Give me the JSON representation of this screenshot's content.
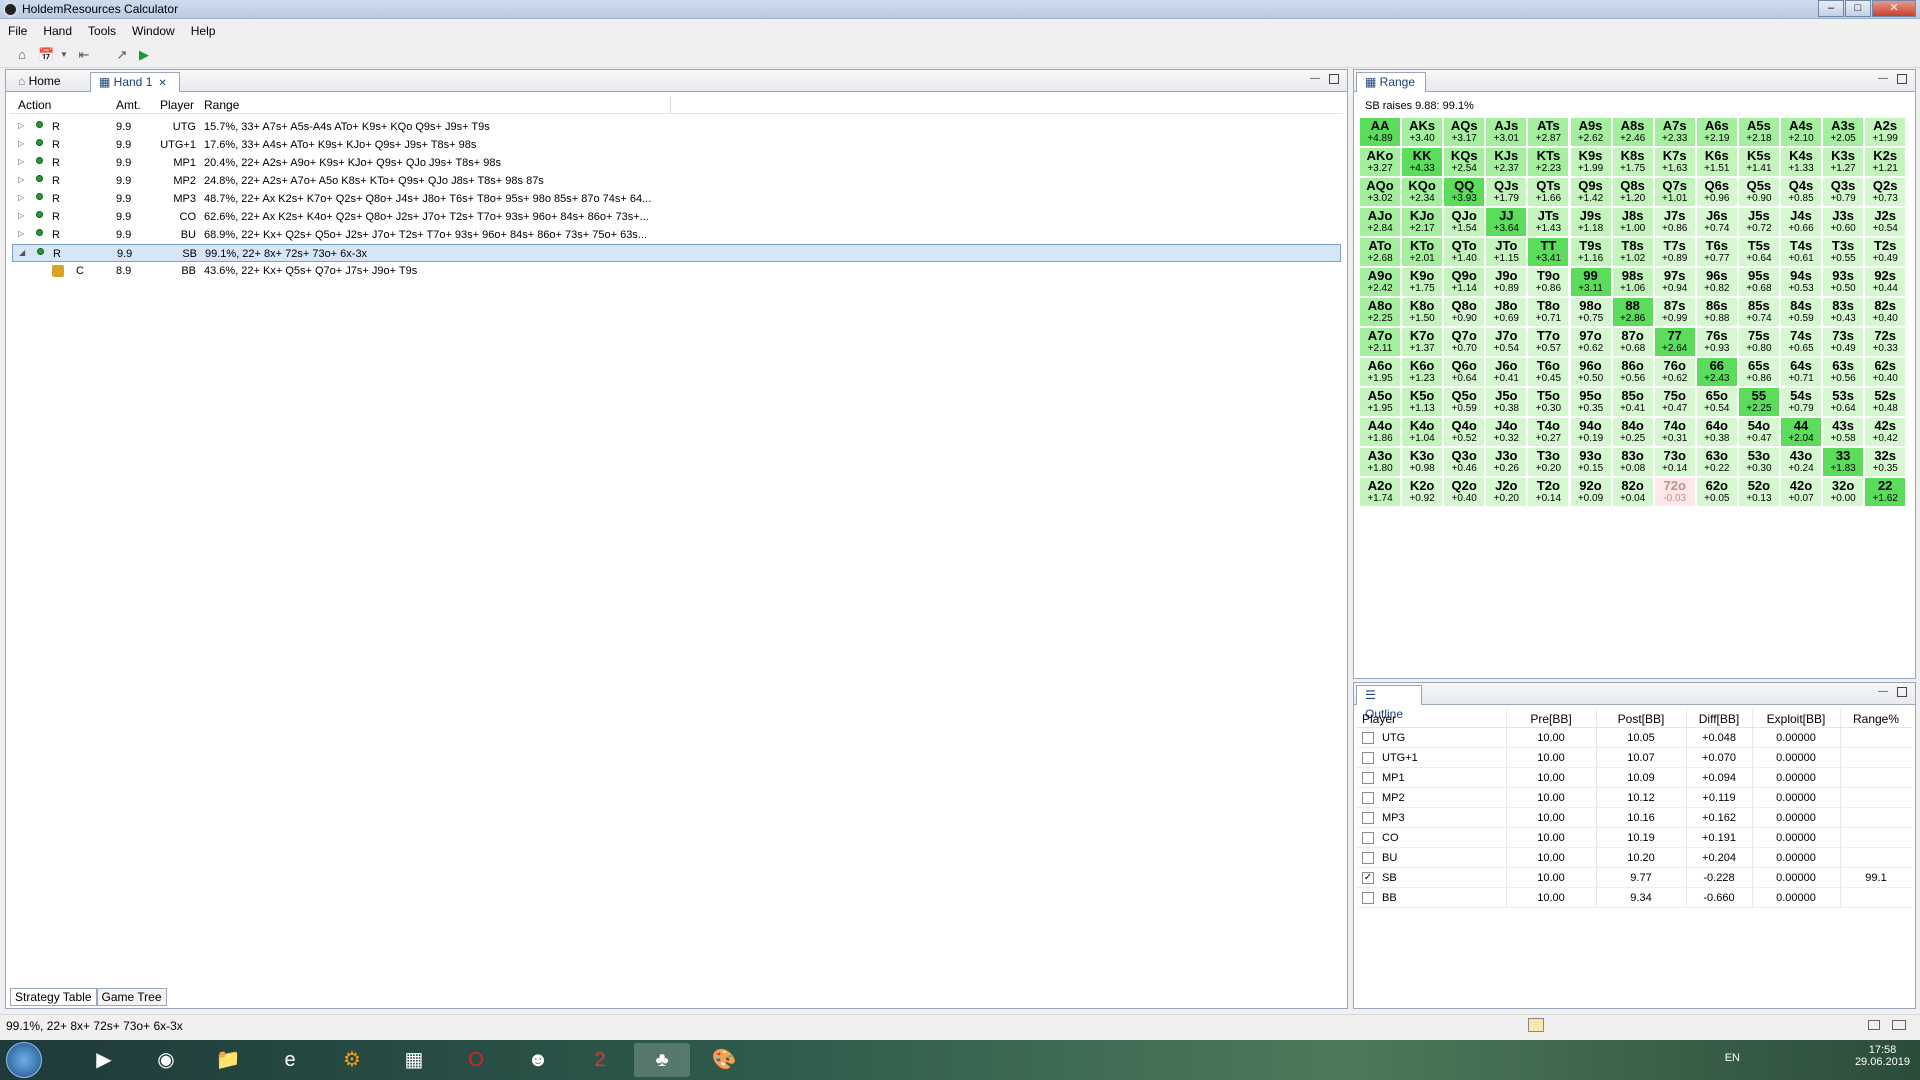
{
  "window": {
    "title": "HoldemResources Calculator"
  },
  "menu": [
    "File",
    "Hand",
    "Tools",
    "Window",
    "Help"
  ],
  "left_tabs": {
    "home": "Home",
    "hand": "Hand 1"
  },
  "strategy": {
    "headers": {
      "action": "Action",
      "amt": "Amt.",
      "player": "Player",
      "range": "Range"
    },
    "rows": [
      {
        "action": "R",
        "amt": "9.9",
        "player": "UTG",
        "range": "15.7%, 33+ A7s+ A5s-A4s ATo+ K9s+ KQo Q9s+ J9s+ T9s"
      },
      {
        "action": "R",
        "amt": "9.9",
        "player": "UTG+1",
        "range": "17.6%, 33+ A4s+ ATo+ K9s+ KJo+ Q9s+ J9s+ T8s+ 98s"
      },
      {
        "action": "R",
        "amt": "9.9",
        "player": "MP1",
        "range": "20.4%, 22+ A2s+ A9o+ K9s+ KJo+ Q9s+ QJo J9s+ T8s+ 98s"
      },
      {
        "action": "R",
        "amt": "9.9",
        "player": "MP2",
        "range": "24.8%, 22+ A2s+ A7o+ A5o K8s+ KTo+ Q9s+ QJo J8s+ T8s+ 98s 87s"
      },
      {
        "action": "R",
        "amt": "9.9",
        "player": "MP3",
        "range": "48.7%, 22+ Ax K2s+ K7o+ Q2s+ Q8o+ J4s+ J8o+ T6s+ T8o+ 95s+ 98o 85s+ 87o 74s+ 64..."
      },
      {
        "action": "R",
        "amt": "9.9",
        "player": "CO",
        "range": "62.6%, 22+ Ax K2s+ K4o+ Q2s+ Q8o+ J2s+ J7o+ T2s+ T7o+ 93s+ 96o+ 84s+ 86o+ 73s+..."
      },
      {
        "action": "R",
        "amt": "9.9",
        "player": "BU",
        "range": "68.9%, 22+ Kx+ Q2s+ Q5o+ J2s+ J7o+ T2s+ T7o+ 93s+ 96o+ 84s+ 86o+ 73s+ 75o+ 63s..."
      },
      {
        "action": "R",
        "amt": "9.9",
        "player": "SB",
        "range": "99.1%, 22+ 8x+ 72s+ 73o+ 6x-3x"
      },
      {
        "action": "C",
        "amt": "8.9",
        "player": "BB",
        "range": "43.6%, 22+ Kx+ Q5s+ Q7o+ J7s+ J9o+ T9s"
      }
    ]
  },
  "bottom_tabs": {
    "strategy": "Strategy Table",
    "tree": "Game Tree"
  },
  "status": {
    "text": "99.1%, 22+ 8x+ 72s+ 73o+ 6x-3x"
  },
  "range_panel": {
    "tab": "Range",
    "header": "SB raises 9.88: 99.1%",
    "hands": [
      "AA",
      "AKs",
      "AQs",
      "AJs",
      "ATs",
      "A9s",
      "A8s",
      "A7s",
      "A6s",
      "A5s",
      "A4s",
      "A3s",
      "A2s",
      "AKo",
      "KK",
      "KQs",
      "KJs",
      "KTs",
      "K9s",
      "K8s",
      "K7s",
      "K6s",
      "K5s",
      "K4s",
      "K3s",
      "K2s",
      "AQo",
      "KQo",
      "QQ",
      "QJs",
      "QTs",
      "Q9s",
      "Q8s",
      "Q7s",
      "Q6s",
      "Q5s",
      "Q4s",
      "Q3s",
      "Q2s",
      "AJo",
      "KJo",
      "QJo",
      "JJ",
      "JTs",
      "J9s",
      "J8s",
      "J7s",
      "J6s",
      "J5s",
      "J4s",
      "J3s",
      "J2s",
      "ATo",
      "KTo",
      "QTo",
      "JTo",
      "TT",
      "T9s",
      "T8s",
      "T7s",
      "T6s",
      "T5s",
      "T4s",
      "T3s",
      "T2s",
      "A9o",
      "K9o",
      "Q9o",
      "J9o",
      "T9o",
      "99",
      "98s",
      "97s",
      "96s",
      "95s",
      "94s",
      "93s",
      "92s",
      "A8o",
      "K8o",
      "Q8o",
      "J8o",
      "T8o",
      "98o",
      "88",
      "87s",
      "86s",
      "85s",
      "84s",
      "83s",
      "82s",
      "A7o",
      "K7o",
      "Q7o",
      "J7o",
      "T7o",
      "97o",
      "87o",
      "77",
      "76s",
      "75s",
      "74s",
      "73s",
      "72s",
      "A6o",
      "K6o",
      "Q6o",
      "J6o",
      "T6o",
      "96o",
      "86o",
      "76o",
      "66",
      "65s",
      "64s",
      "63s",
      "62s",
      "A5o",
      "K5o",
      "Q5o",
      "J5o",
      "T5o",
      "95o",
      "85o",
      "75o",
      "65o",
      "55",
      "54s",
      "53s",
      "52s",
      "A4o",
      "K4o",
      "Q4o",
      "J4o",
      "T4o",
      "94o",
      "84o",
      "74o",
      "64o",
      "54o",
      "44",
      "43s",
      "42s",
      "A3o",
      "K3o",
      "Q3o",
      "J3o",
      "T3o",
      "93o",
      "83o",
      "73o",
      "63o",
      "53o",
      "43o",
      "33",
      "32s",
      "A2o",
      "K2o",
      "Q2o",
      "J2o",
      "T2o",
      "92o",
      "82o",
      "72o",
      "62o",
      "52o",
      "42o",
      "32o",
      "22"
    ],
    "values": [
      "+4.89",
      "+3.40",
      "+3.17",
      "+3.01",
      "+2.87",
      "+2.62",
      "+2.46",
      "+2.33",
      "+2.19",
      "+2.18",
      "+2.10",
      "+2.05",
      "+1.99",
      "+3.27",
      "+4.33",
      "+2.54",
      "+2.37",
      "+2.23",
      "+1.99",
      "+1.75",
      "+1.63",
      "+1.51",
      "+1.41",
      "+1.33",
      "+1.27",
      "+1.21",
      "+3.02",
      "+2.34",
      "+3.93",
      "+1.79",
      "+1.66",
      "+1.42",
      "+1.20",
      "+1.01",
      "+0.96",
      "+0.90",
      "+0.85",
      "+0.79",
      "+0.73",
      "+2.84",
      "+2.17",
      "+1.54",
      "+3.64",
      "+1.43",
      "+1.18",
      "+1.00",
      "+0.86",
      "+0.74",
      "+0.72",
      "+0.66",
      "+0.60",
      "+0.54",
      "+2.68",
      "+2.01",
      "+1.40",
      "+1.15",
      "+3.41",
      "+1.16",
      "+1.02",
      "+0.89",
      "+0.77",
      "+0.64",
      "+0.61",
      "+0.55",
      "+0.49",
      "+2.42",
      "+1.75",
      "+1.14",
      "+0.89",
      "+0.86",
      "+3.11",
      "+1.06",
      "+0.94",
      "+0.82",
      "+0.68",
      "+0.53",
      "+0.50",
      "+0.44",
      "+2.25",
      "+1.50",
      "+0.90",
      "+0.69",
      "+0.71",
      "+0.75",
      "+2.86",
      "+0.99",
      "+0.88",
      "+0.74",
      "+0.59",
      "+0.43",
      "+0.40",
      "+2.11",
      "+1.37",
      "+0.70",
      "+0.54",
      "+0.57",
      "+0.62",
      "+0.68",
      "+2.64",
      "+0.93",
      "+0.80",
      "+0.65",
      "+0.49",
      "+0.33",
      "+1.95",
      "+1.23",
      "+0.64",
      "+0.41",
      "+0.45",
      "+0.50",
      "+0.56",
      "+0.62",
      "+2.43",
      "+0.86",
      "+0.71",
      "+0.56",
      "+0.40",
      "+1.95",
      "+1.13",
      "+0.59",
      "+0.38",
      "+0.30",
      "+0.35",
      "+0.41",
      "+0.47",
      "+0.54",
      "+2.25",
      "+0.79",
      "+0.64",
      "+0.48",
      "+1.86",
      "+1.04",
      "+0.52",
      "+0.32",
      "+0.27",
      "+0.19",
      "+0.25",
      "+0.31",
      "+0.38",
      "+0.47",
      "+2.04",
      "+0.58",
      "+0.42",
      "+1.80",
      "+0.98",
      "+0.46",
      "+0.26",
      "+0.20",
      "+0.15",
      "+0.08",
      "+0.14",
      "+0.22",
      "+0.30",
      "+0.24",
      "+1.83",
      "+0.35",
      "+1.74",
      "+0.92",
      "+0.40",
      "+0.20",
      "+0.14",
      "+0.09",
      "+0.04",
      "-0.03",
      "+0.05",
      "+0.13",
      "+0.07",
      "+0.00",
      "+1.62"
    ]
  },
  "outline_panel": {
    "tab": "Outline",
    "headers": {
      "player": "Player",
      "pre": "Pre[BB]",
      "post": "Post[BB]",
      "diff": "Diff[BB]",
      "exploit": "Exploit[BB]",
      "range": "Range%"
    },
    "rows": [
      {
        "player": "UTG",
        "pre": "10.00",
        "post": "10.05",
        "diff": "+0.048",
        "exploit": "0.00000",
        "range": "",
        "checked": false
      },
      {
        "player": "UTG+1",
        "pre": "10.00",
        "post": "10.07",
        "diff": "+0.070",
        "exploit": "0.00000",
        "range": "",
        "checked": false
      },
      {
        "player": "MP1",
        "pre": "10.00",
        "post": "10.09",
        "diff": "+0.094",
        "exploit": "0.00000",
        "range": "",
        "checked": false
      },
      {
        "player": "MP2",
        "pre": "10.00",
        "post": "10.12",
        "diff": "+0.119",
        "exploit": "0.00000",
        "range": "",
        "checked": false
      },
      {
        "player": "MP3",
        "pre": "10.00",
        "post": "10.16",
        "diff": "+0.162",
        "exploit": "0.00000",
        "range": "",
        "checked": false
      },
      {
        "player": "CO",
        "pre": "10.00",
        "post": "10.19",
        "diff": "+0.191",
        "exploit": "0.00000",
        "range": "",
        "checked": false
      },
      {
        "player": "BU",
        "pre": "10.00",
        "post": "10.20",
        "diff": "+0.204",
        "exploit": "0.00000",
        "range": "",
        "checked": false
      },
      {
        "player": "SB",
        "pre": "10.00",
        "post": "9.77",
        "diff": "-0.228",
        "exploit": "0.00000",
        "range": "99.1",
        "checked": true
      },
      {
        "player": "BB",
        "pre": "10.00",
        "post": "9.34",
        "diff": "-0.660",
        "exploit": "0.00000",
        "range": "",
        "checked": false
      }
    ]
  },
  "taskbar": {
    "lang": "EN",
    "time": "17:58",
    "date": "29.06.2019",
    "badge": "2"
  },
  "colors": {
    "strong_green": "#5bdc5b",
    "mid_green": "#a4ef9e",
    "light_green": "#d6f8d0",
    "negative": "#ffe8e8",
    "selection": "#d6e6f8"
  }
}
